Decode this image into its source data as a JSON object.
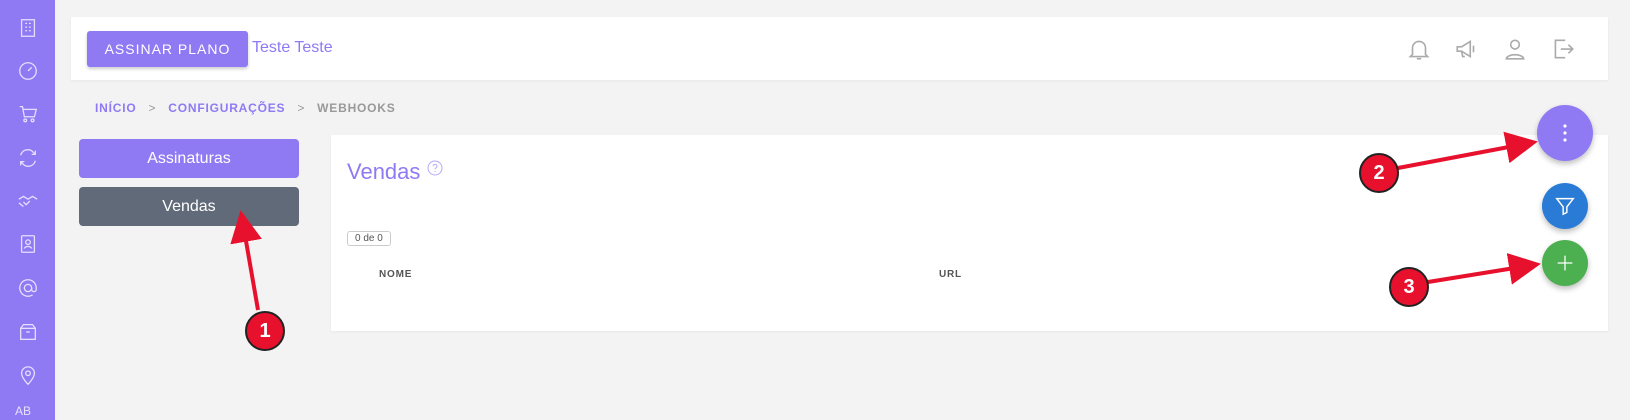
{
  "sidebar": {
    "icons": [
      "building-icon",
      "dashboard-gauge-icon",
      "cart-icon",
      "refresh-icon",
      "handshake-icon",
      "contacts-book-icon",
      "at-sign-icon",
      "package-icon",
      "location-pin-icon"
    ],
    "bottom_label": "AB"
  },
  "header": {
    "plan_button": "ASSINAR PLANO",
    "user_name": "Teste Teste",
    "icons": [
      "bell-icon",
      "megaphone-icon",
      "user-icon",
      "logout-icon"
    ]
  },
  "breadcrumb": {
    "items": [
      "INÍCIO",
      "CONFIGURAÇÕES",
      "WEBHOOKS"
    ],
    "separator": ">"
  },
  "side_menu": {
    "items": [
      "Assinaturas",
      "Vendas"
    ],
    "active": "Vendas"
  },
  "main": {
    "title": "Vendas",
    "count": "0 de 0",
    "columns": [
      "NOME",
      "URL"
    ]
  },
  "annotations": [
    "1",
    "2",
    "3"
  ],
  "colors": {
    "accent": "#8f7af4",
    "active_menu": "#616a78",
    "filter_fab": "#2a7bd5",
    "add_fab": "#4caf50",
    "marker": "#e8112d"
  }
}
